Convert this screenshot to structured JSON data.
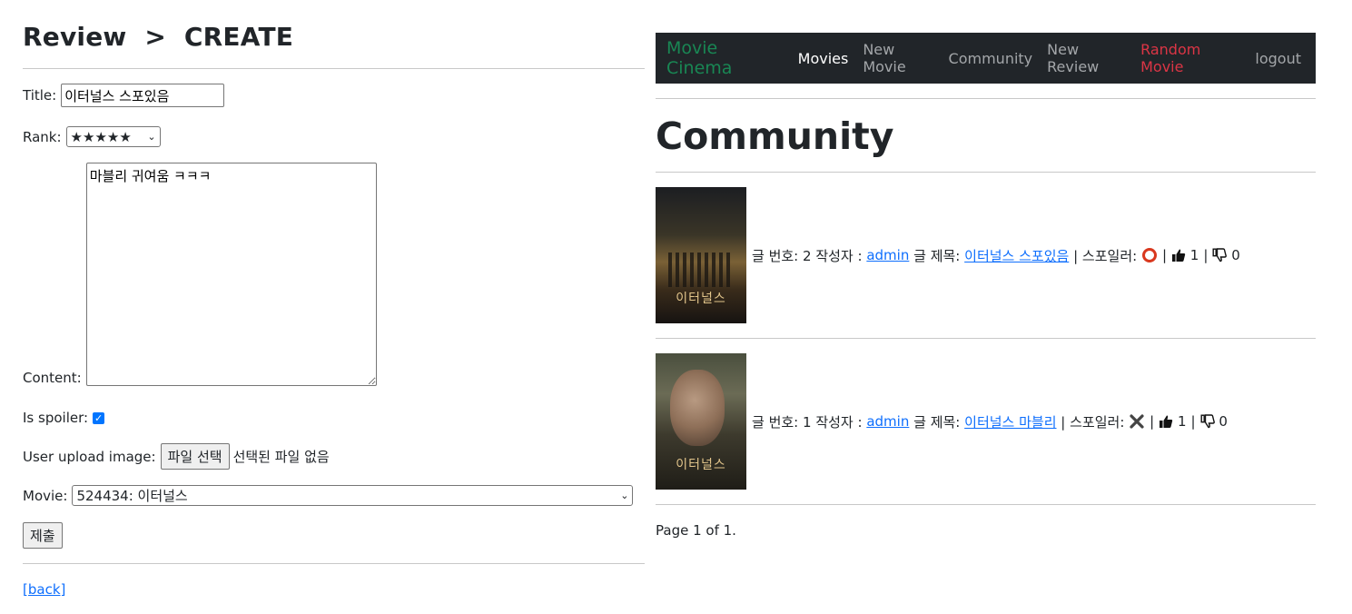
{
  "review_form": {
    "heading": "Review  >  CREATE",
    "title_label": "Title:",
    "title_value": "이터널스 스포있음",
    "rank_label": "Rank:",
    "rank_value": "★★★★★",
    "content_label": "Content:",
    "content_value": "마블리 귀여움 ㅋㅋㅋ",
    "spoiler_label": "Is spoiler:",
    "spoiler_checked": true,
    "upload_label": "User upload image:",
    "upload_button": "파일 선택",
    "upload_status": "선택된 파일 없음",
    "movie_label": "Movie:",
    "movie_value": "524434: 이터널스",
    "submit_label": "제출",
    "back_link": "[back]"
  },
  "navbar": {
    "brand": "Movie Cinema",
    "items": [
      {
        "label": "Movies",
        "active": true
      },
      {
        "label": "New Movie"
      },
      {
        "label": "Community"
      },
      {
        "label": "New Review"
      },
      {
        "label": "Random Movie",
        "color": "#dc3545"
      },
      {
        "label": "logout"
      }
    ]
  },
  "community": {
    "title": "Community",
    "posts": [
      {
        "number_label": "글 번호: 2",
        "author_prefix": "작성자 :",
        "author": "admin",
        "title_prefix": "글 제목:",
        "title": "이터널스 스포있음",
        "spoiler_label": "| 스포일러:",
        "spoiler_icon": "circle-o-icon",
        "likes": "1",
        "dislikes": "0",
        "poster_text": "이터널스"
      },
      {
        "number_label": "글 번호: 1",
        "author_prefix": "작성자 :",
        "author": "admin",
        "title_prefix": "글 제목:",
        "title": "이터널스 마블리",
        "spoiler_label": "| 스포일러:",
        "spoiler_icon": "x-mark-icon",
        "likes": "1",
        "dislikes": "0",
        "poster_text": "이터널스"
      }
    ],
    "pagination": "Page 1 of 1."
  },
  "colors": {
    "navbar_bg": "#212529",
    "brand": "#198754",
    "link": "#0d6efd",
    "random": "#dc3545"
  }
}
